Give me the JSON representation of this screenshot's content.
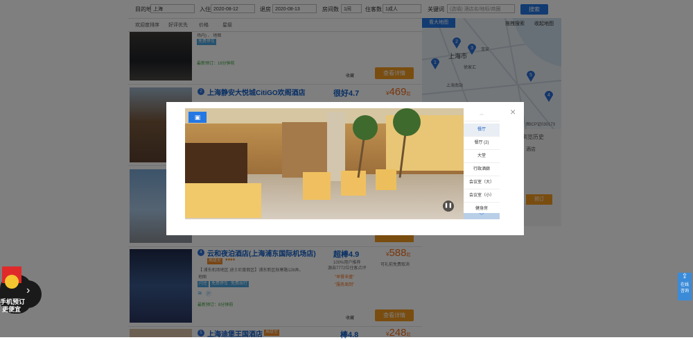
{
  "search": {
    "dest_label": "目的地",
    "dest_value": "上海",
    "checkin_label": "入住",
    "checkin_value": "2020-08-12",
    "checkout_label": "退房",
    "checkout_value": "2020-08-13",
    "rooms_label": "房间数",
    "rooms_value": "1间",
    "guests_label": "住客数",
    "guests_value": "1成人",
    "keyword_label": "关键词",
    "keyword_placeholder": "(选填) 酒店名/地标/商圈",
    "button": "搜索"
  },
  "sort": [
    "欢迎度排序",
    "好评优先",
    "价格",
    "星级"
  ],
  "cards": [
    {
      "partial_text": "场内) 、 地图",
      "tag": "免费停车",
      "booked": "最新预订：16分钟前",
      "fav": "收藏",
      "detail": "查看详情"
    },
    {
      "num": "2",
      "name": "上海静安大悦城CitiGO欢阁酒店",
      "score": "很好4.7",
      "price_symbol": "¥",
      "price": "469",
      "price_suffix": "起"
    },
    {
      "num": "4",
      "name": "云和夜泊酒店(上海浦东国际机场店)",
      "tag": "高级型",
      "score": "超棒4.9",
      "recommend": "100%用户推荐",
      "reviews": "源自7772位住客点评",
      "quote1": "\"早餐丰盛\"",
      "quote2": "\"服务周到\"",
      "address": "【 浦东机场地区 迪士尼度假区】浦东新区秋寒路128弄。",
      "map": "地图",
      "tags": [
        "闪住",
        "免费停车",
        "免费出行"
      ],
      "booked": "最新预订：8分钟前",
      "price_symbol": "¥",
      "price": "588",
      "price_suffix": "起",
      "cancel": "可礼前免费取消",
      "fav": "收藏",
      "detail": "查看详情"
    },
    {
      "num": "5",
      "name": "上海迪堡王国酒店",
      "tag": "高级型",
      "score": "棒4.8",
      "price_symbol": "¥",
      "price": "248",
      "price_suffix": "起"
    }
  ],
  "map": {
    "big_map": "看大地图",
    "drag_search": "拖拽搜索",
    "collapse": "收起地图",
    "city": "上海市",
    "districts": [
      "宝安",
      "徐家汇",
      "上海南站"
    ],
    "icp": "图ICP证030173",
    "pins": [
      "1",
      "2",
      "3",
      "4",
      "5"
    ]
  },
  "side": {
    "history": "浏览历史",
    "hotels": "酒店",
    "book": "预订"
  },
  "modal": {
    "rooms": [
      "餐厅",
      "餐厅 (2)",
      "大堂",
      "行政酒廊",
      "会议室（大）",
      "会议室（小）",
      "健身房"
    ],
    "active_index": 0,
    "close": "×"
  },
  "promo": {
    "line1": "手机预订",
    "line2": "更便宜"
  },
  "feedback": {
    "line1": "在线",
    "line2": "咨询"
  },
  "colors": {
    "accent": "#2577e3",
    "price": "#f26c16",
    "button": "#f39a20",
    "link": "#0e5dc8"
  }
}
